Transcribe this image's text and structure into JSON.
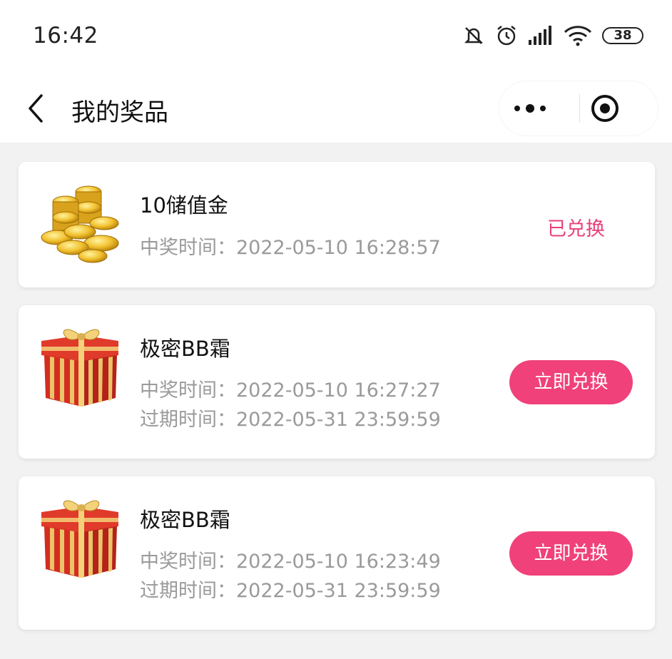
{
  "status_bar": {
    "time": "16:42",
    "battery": "38"
  },
  "nav": {
    "title": "我的奖品",
    "back_icon": "chevron-left-icon",
    "more_icon": "more-dots-icon",
    "close_icon": "record-circle-icon"
  },
  "colors": {
    "accent": "#f0417a",
    "status_text": "#e8407a",
    "muted": "#9a9a9a"
  },
  "prizes": [
    {
      "name": "10储值金",
      "image": "gold-coins",
      "lines": [
        "中奖时间：2022-05-10 16:28:57"
      ],
      "status": "已兑换",
      "action": ""
    },
    {
      "name": "极密BB霜",
      "image": "gift-box",
      "lines": [
        "中奖时间：2022-05-10 16:27:27",
        "过期时间：2022-05-31 23:59:59"
      ],
      "status": "",
      "action": "立即兑换"
    },
    {
      "name": "极密BB霜",
      "image": "gift-box",
      "lines": [
        "中奖时间：2022-05-10 16:23:49",
        "过期时间：2022-05-31 23:59:59"
      ],
      "status": "",
      "action": "立即兑换"
    }
  ]
}
